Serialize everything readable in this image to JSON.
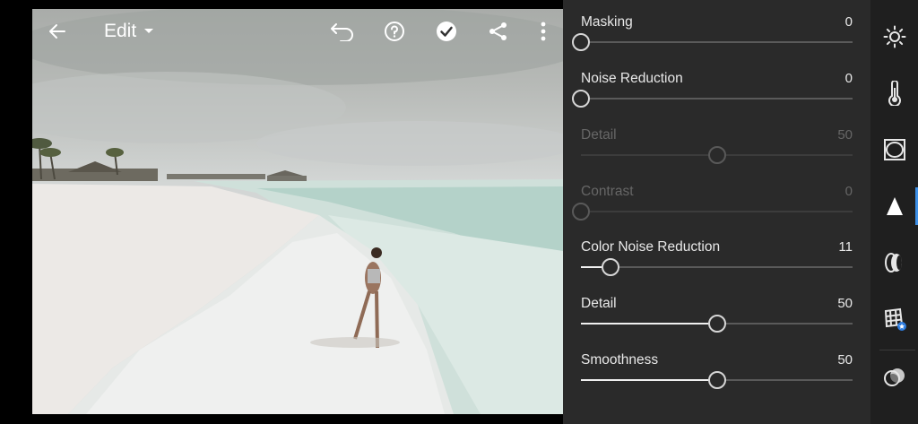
{
  "toolbar": {
    "edit_label": "Edit",
    "icons": [
      "back-arrow-icon",
      "chevron-down-icon",
      "undo-icon",
      "help-icon",
      "checkmark-icon",
      "share-icon",
      "more-icon"
    ]
  },
  "panel": {
    "sliders": [
      {
        "label": "Masking",
        "value": "0",
        "fraction": 0.0,
        "enabled": true
      },
      {
        "label": "Noise Reduction",
        "value": "0",
        "fraction": 0.0,
        "enabled": true
      },
      {
        "label": "Detail",
        "value": "50",
        "fraction": 0.5,
        "enabled": false
      },
      {
        "label": "Contrast",
        "value": "0",
        "fraction": 0.0,
        "enabled": false
      },
      {
        "label": "Color Noise Reduction",
        "value": "11",
        "fraction": 0.11,
        "enabled": true
      },
      {
        "label": "Detail",
        "value": "50",
        "fraction": 0.5,
        "enabled": true
      },
      {
        "label": "Smoothness",
        "value": "50",
        "fraction": 0.5,
        "enabled": true
      }
    ]
  },
  "rail": {
    "items": [
      "light-icon",
      "color-icon",
      "effects-icon",
      "detail-icon",
      "optics-icon",
      "geometry-icon",
      "presets-icon"
    ],
    "active_item": "detail-icon",
    "accent_color": "#3d8fe6"
  }
}
